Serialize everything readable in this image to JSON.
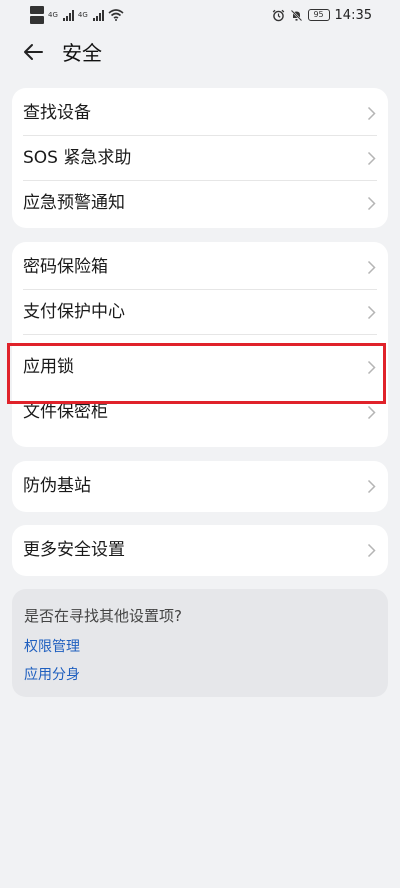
{
  "status_bar": {
    "left_indicators": [
      "HD",
      "HD"
    ],
    "net1": "4G",
    "net2": "4G",
    "battery": "95",
    "time": "14:35",
    "icons": [
      "alarm-icon",
      "mute-icon",
      "wifi-icon",
      "signal-icon"
    ]
  },
  "header": {
    "back_icon": "arrow-left-icon",
    "title": "安全"
  },
  "groups": [
    {
      "items": [
        {
          "label": "查找设备"
        },
        {
          "label": "SOS 紧急求助"
        },
        {
          "label": "应急预警通知"
        }
      ]
    },
    {
      "items": [
        {
          "label": "密码保险箱"
        },
        {
          "label": "支付保护中心"
        },
        {
          "label": "应用锁"
        },
        {
          "label": "文件保密柜"
        }
      ]
    },
    {
      "items": [
        {
          "label": "防伪基站"
        }
      ]
    },
    {
      "items": [
        {
          "label": "更多安全设置"
        }
      ]
    }
  ],
  "help": {
    "title": "是否在寻找其他设置项?",
    "links": [
      "权限管理",
      "应用分身"
    ]
  },
  "colors": {
    "background": "#f1f2f4",
    "card": "#ffffff",
    "link": "#1f5fbf",
    "highlight": "#e0222a"
  }
}
